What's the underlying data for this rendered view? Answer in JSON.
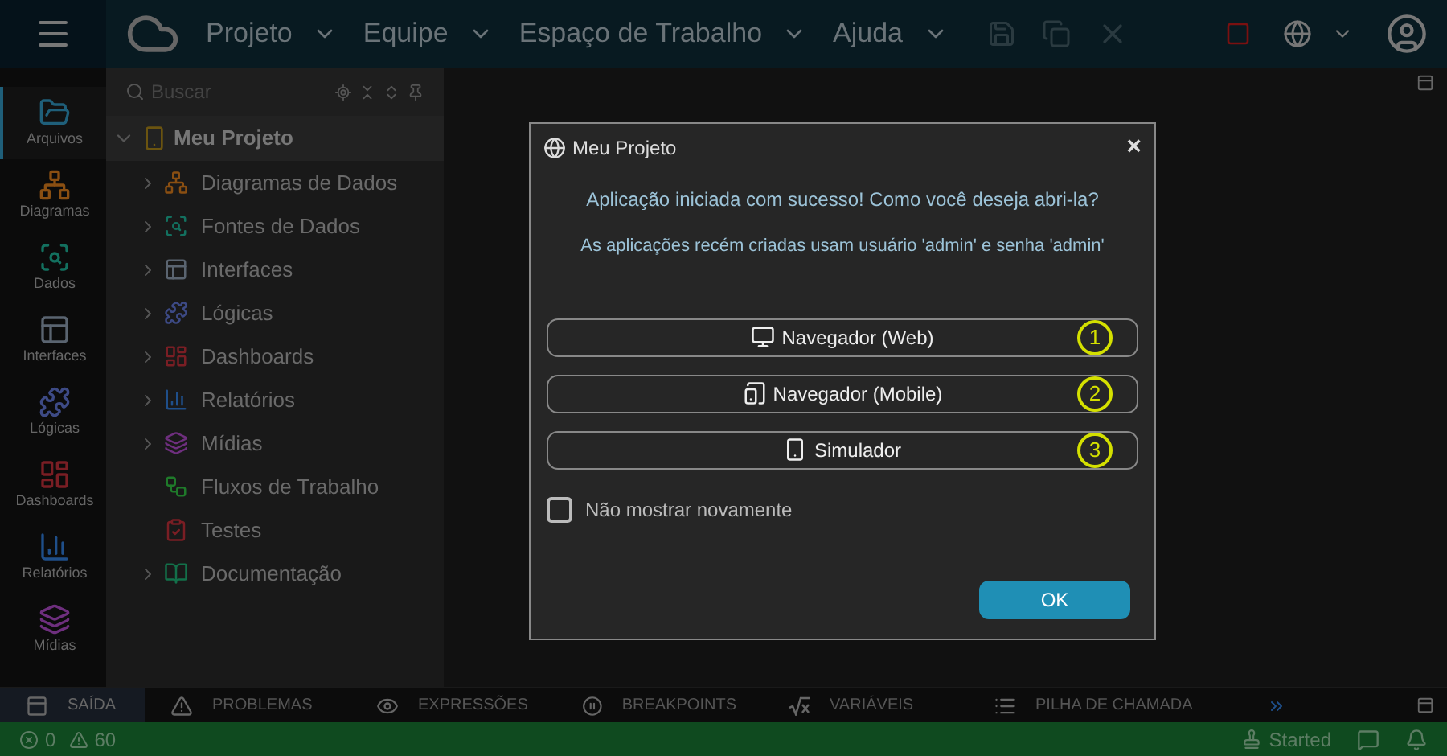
{
  "menu": [
    {
      "label": "Projeto"
    },
    {
      "label": "Equipe"
    },
    {
      "label": "Espaço de Trabalho"
    },
    {
      "label": "Ajuda"
    }
  ],
  "rail": [
    {
      "label": "Arquivos",
      "selected": true,
      "color": "#1f5f7a"
    },
    {
      "label": "Diagramas",
      "selected": false,
      "color": "#8a4f12"
    },
    {
      "label": "Dados",
      "selected": false,
      "color": "#13705f"
    },
    {
      "label": "Interfaces",
      "selected": false,
      "color": "#5a6470"
    },
    {
      "label": "Lógicas",
      "selected": false,
      "color": "#3d4a85"
    },
    {
      "label": "Dashboards",
      "selected": false,
      "color": "#7a1e24"
    },
    {
      "label": "Relatórios",
      "selected": false,
      "color": "#1f4f8a"
    },
    {
      "label": "Mídias",
      "selected": false,
      "color": "#6e2f7e"
    }
  ],
  "search": {
    "placeholder": "Buscar"
  },
  "tree": {
    "label": "Meu Projeto",
    "expanded": true,
    "children": [
      {
        "label": "Diagramas de Dados",
        "kind": "folder",
        "color": "#8a4f12"
      },
      {
        "label": "Fontes de Dados",
        "kind": "folder",
        "color": "#13705f"
      },
      {
        "label": "Interfaces",
        "kind": "folder",
        "color": "#5a6470"
      },
      {
        "label": "Lógicas",
        "kind": "folder",
        "color": "#3d4a85"
      },
      {
        "label": "Dashboards",
        "kind": "folder",
        "color": "#7a1e24"
      },
      {
        "label": "Relatórios",
        "kind": "folder",
        "color": "#1f4f8a"
      },
      {
        "label": "Mídias",
        "kind": "folder",
        "color": "#6e2f7e"
      },
      {
        "label": "Fluxos de Trabalho",
        "kind": "leaf",
        "color": "#1f7a2a"
      },
      {
        "label": "Testes",
        "kind": "leaf",
        "color": "#7a1e24"
      },
      {
        "label": "Documentação",
        "kind": "folder",
        "color": "#13704a"
      }
    ]
  },
  "dialog": {
    "title": "Meu Projeto",
    "close": "×",
    "message": "Aplicação iniciada com sucesso! Como você deseja abri-la?",
    "note": "As aplicações recém criadas usam usuário 'admin' e senha 'admin'",
    "options": [
      {
        "label": "Navegador (Web)",
        "kind": "web",
        "number": "1"
      },
      {
        "label": "Navegador (Mobile)",
        "kind": "mobile",
        "number": "2"
      },
      {
        "label": "Simulador",
        "kind": "simulator",
        "number": "3"
      }
    ],
    "checkbox": {
      "label": "Não mostrar novamente",
      "checked": false
    },
    "ok": "OK"
  },
  "bottom_tabs": [
    {
      "label": "SAÍDA",
      "selected": true
    },
    {
      "label": "PROBLEMAS",
      "selected": false
    },
    {
      "label": "EXPRESSÕES",
      "selected": false
    },
    {
      "label": "BREAKPOINTS",
      "selected": false
    },
    {
      "label": "VARIÁVEIS",
      "selected": false
    },
    {
      "label": "PILHA DE CHAMADA",
      "selected": false
    }
  ],
  "status_bar": {
    "errors": "0",
    "warnings": "60",
    "server": "Started"
  }
}
